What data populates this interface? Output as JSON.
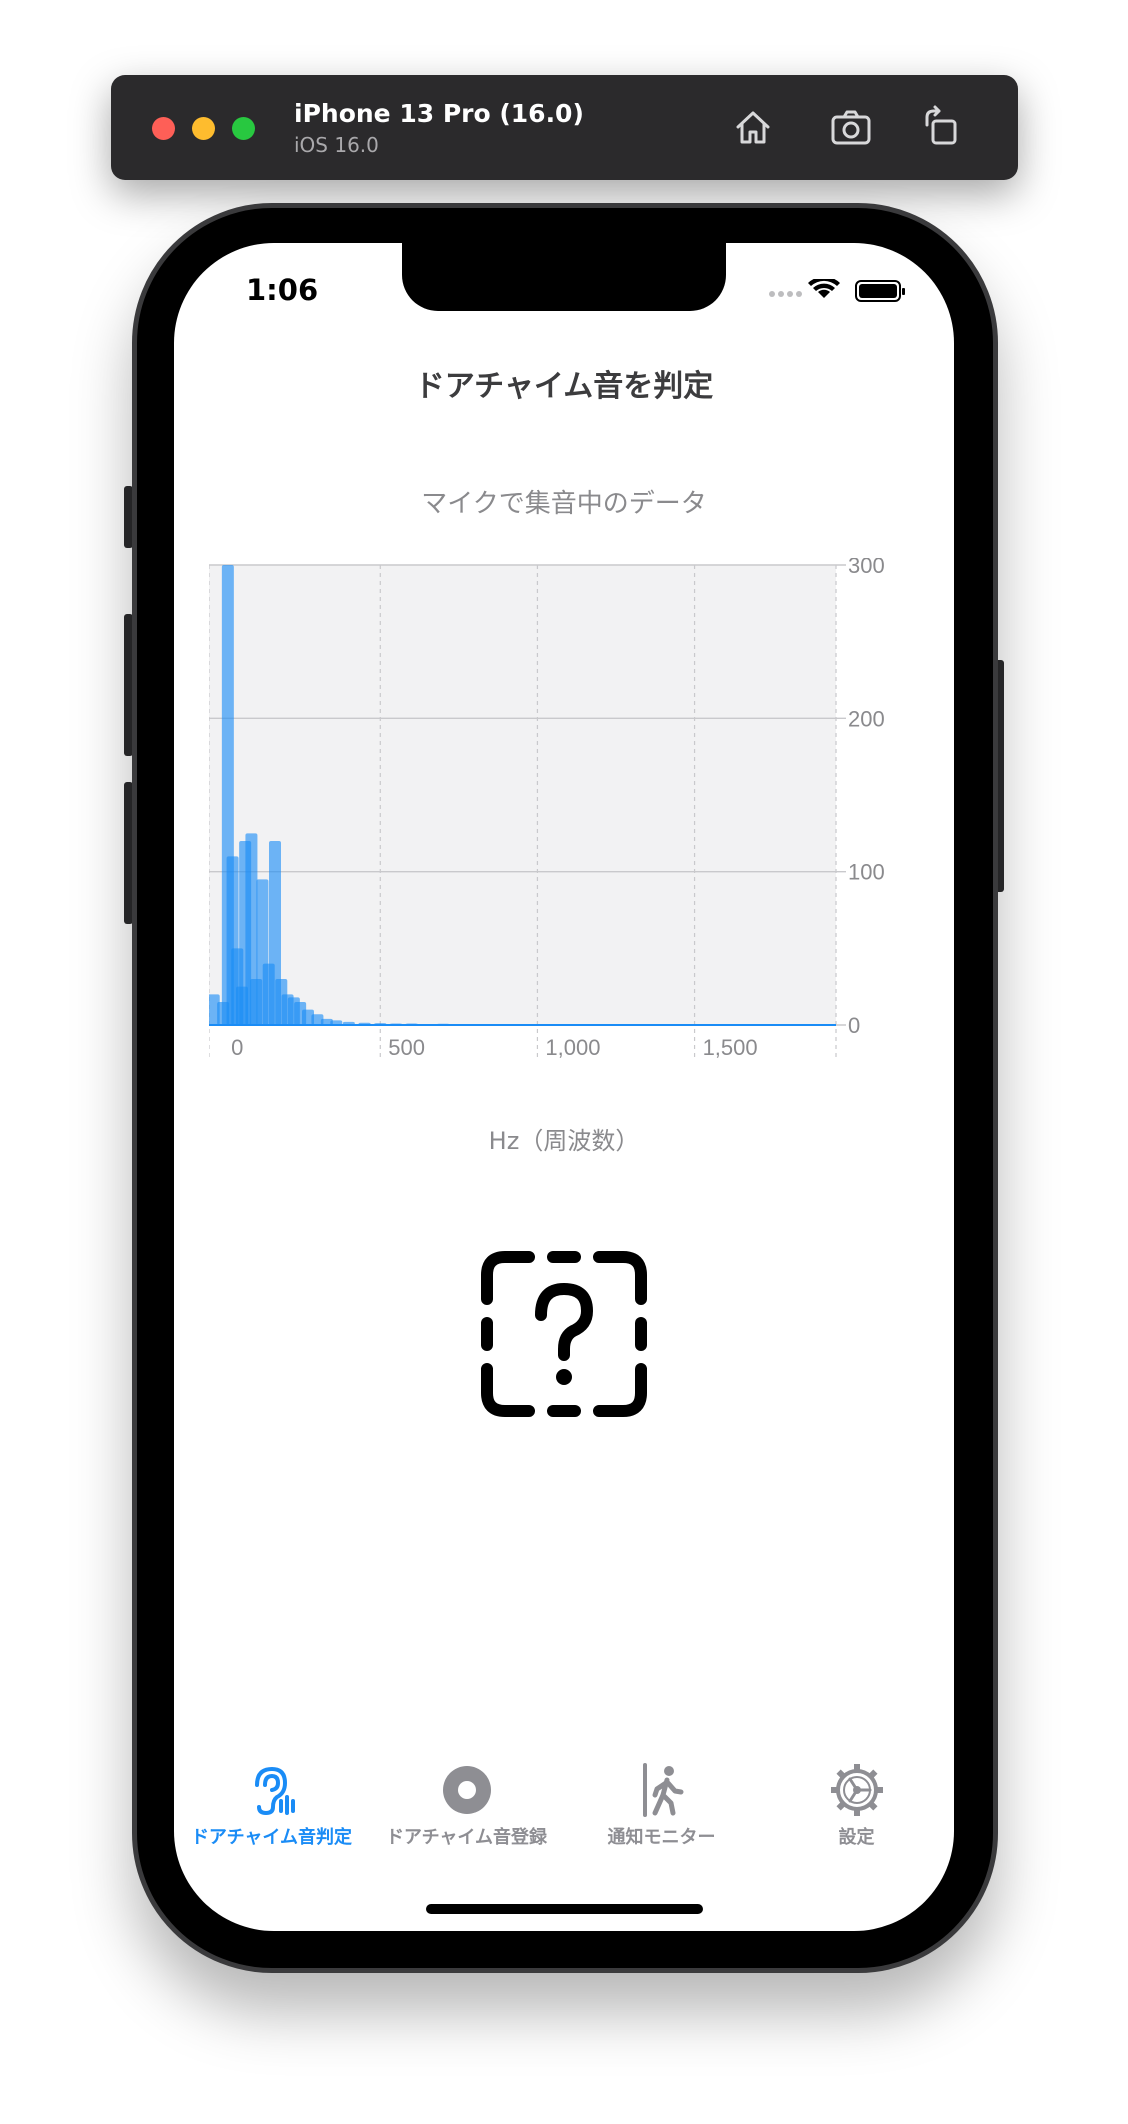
{
  "simulator": {
    "title": "iPhone 13 Pro (16.0)",
    "subtitle": "iOS 16.0",
    "buttons": [
      "home-icon",
      "screenshot-icon",
      "rotate-icon"
    ]
  },
  "status_bar": {
    "time": "1:06"
  },
  "screen": {
    "nav_title": "ドアチャイム音を判定",
    "chart_caption": "マイクで集音中のデータ",
    "x_axis_label": "Hz（周波数）"
  },
  "result_icon": "questionmark-dashed-square-icon",
  "colors": {
    "accent": "#1a8cf6",
    "inactive": "#8e8e93",
    "bar": "#1a8cf6"
  },
  "tabs": [
    {
      "label": "ドアチャイム音判定",
      "icon": "ear-sound-icon",
      "active": true
    },
    {
      "label": "ドアチャイム音登録",
      "icon": "record-circle-icon",
      "active": false
    },
    {
      "label": "通知モニター",
      "icon": "person-walking-icon",
      "active": false
    },
    {
      "label": "設定",
      "icon": "gear-icon",
      "active": false
    }
  ],
  "chart_data": {
    "type": "bar",
    "xlabel": "Hz（周波数）",
    "ylabel": "",
    "xlim": [
      -45,
      1950
    ],
    "ylim": [
      0,
      300
    ],
    "x_ticks": [
      0,
      500,
      1000,
      1500
    ],
    "x_tick_labels": [
      "0",
      "500",
      "1,000",
      "1,500"
    ],
    "y_ticks": [
      0,
      100,
      200,
      300
    ],
    "y_tick_labels": [
      "0",
      "100",
      "200",
      "300"
    ],
    "y_axis_side": "right",
    "grid": true,
    "series": [
      {
        "x": [
          -30,
          0,
          15,
          30,
          45,
          60,
          70,
          90,
          105,
          125,
          145,
          165,
          185,
          205,
          225,
          245,
          270,
          300,
          330,
          360,
          400,
          450,
          500,
          550,
          600,
          700,
          800,
          900,
          1000,
          1100,
          1200,
          1300,
          1400,
          1500,
          1600,
          1700,
          1800
        ],
        "y": [
          20,
          15,
          300,
          110,
          50,
          25,
          120,
          125,
          30,
          95,
          40,
          120,
          30,
          20,
          18,
          15,
          10,
          7,
          4,
          3,
          2,
          1.5,
          1.2,
          1,
          1,
          0.8,
          0.6,
          0.5,
          0.5,
          0.4,
          0.4,
          0.3,
          0.3,
          0.3,
          0.2,
          0.2,
          0.2
        ]
      }
    ]
  }
}
